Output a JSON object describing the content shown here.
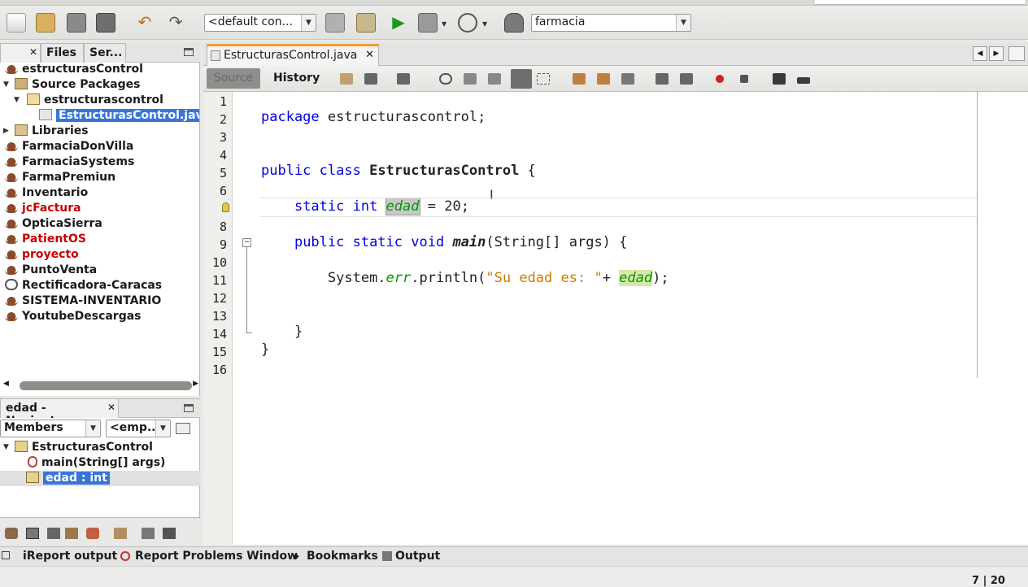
{
  "toolbar": {
    "config_combo": "<default con...",
    "project_combo": "farmacia"
  },
  "projects": {
    "tabs": [
      "Files",
      "Ser..."
    ],
    "tree": [
      {
        "label": "estructurasControl",
        "red": false
      },
      {
        "label": "Source Packages",
        "red": false
      },
      {
        "label": "estructurascontrol",
        "red": false
      },
      {
        "label": "EstructurasControl.java",
        "red": false,
        "selected": true
      },
      {
        "label": "Libraries",
        "red": false
      },
      {
        "label": "FarmaciaDonVilla",
        "red": false
      },
      {
        "label": "FarmaciaSystems",
        "red": false
      },
      {
        "label": "FarmaPremiun",
        "red": false
      },
      {
        "label": "Inventario",
        "red": false
      },
      {
        "label": "jcFactura",
        "red": true
      },
      {
        "label": "OpticaSierra",
        "red": false
      },
      {
        "label": "PatientOS",
        "red": true
      },
      {
        "label": "proyecto",
        "red": true
      },
      {
        "label": "PuntoVenta",
        "red": false
      },
      {
        "label": "Rectificadora-Caracas",
        "red": false
      },
      {
        "label": "SISTEMA-INVENTARIO",
        "red": false
      },
      {
        "label": "YoutubeDescargas",
        "red": false
      }
    ]
  },
  "navigator": {
    "title": "edad - Navigator",
    "members_combo": "Members",
    "filter_combo": "<emp...",
    "tree": [
      {
        "label": "EstructurasControl"
      },
      {
        "label": "main(String[] args)"
      },
      {
        "label": "edad : int",
        "selected": true
      }
    ]
  },
  "editor": {
    "tab_label": "EstructurasControl.java",
    "source_label": "Source",
    "history_label": "History",
    "line_numbers": [
      "1",
      "2",
      "3",
      "4",
      "5",
      "6",
      "7",
      "8",
      "9",
      "10",
      "11",
      "12",
      "13",
      "14",
      "15",
      "16"
    ],
    "code": {
      "l2_kw": "package",
      "l2_rest": " estructurascontrol;",
      "l5_kw": "public class",
      "l5_name": "EstructurasControl",
      "l5_rest": " {",
      "l7_indent": "    ",
      "l7_kw": "static int",
      "l7_field": "edad",
      "l7_rest": " = 20;",
      "l9_indent": "    ",
      "l9_kw": "public static void",
      "l9_name": "main",
      "l9_rest": "(String[] args) {",
      "l11_indent": "        ",
      "l11_a": "System.",
      "l11_err": "err",
      "l11_b": ".println(",
      "l11_str": "\"Su edad es: \"",
      "l11_c": "+ ",
      "l11_field": "edad",
      "l11_d": ");",
      "l14": "    }",
      "l15": "}"
    }
  },
  "bottom_tabs": [
    "iReport output",
    "Report Problems Window",
    "Bookmarks",
    "Output"
  ],
  "status": {
    "position": "7 | 20"
  },
  "colors": {
    "selection": "#3875d7",
    "keyword": "#0000e6",
    "field": "#009900",
    "string": "#ce7b00",
    "error_project": "#c80000"
  }
}
